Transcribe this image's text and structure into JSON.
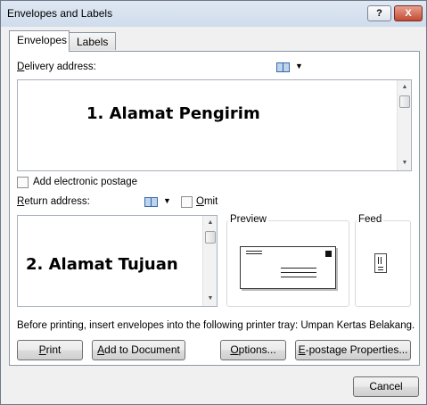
{
  "window": {
    "title": "Envelopes and Labels",
    "help_label": "?",
    "close_label": "X"
  },
  "tabs": [
    {
      "label": "Envelopes"
    },
    {
      "label": "Labels"
    }
  ],
  "delivery": {
    "label_prefix": "D",
    "label_rest": "elivery address:",
    "value": "1. Alamat Pengirim"
  },
  "electronic_postage": {
    "label": "Add electronic postage",
    "checked": false
  },
  "return": {
    "label_prefix": "R",
    "label_rest": "eturn address:",
    "value": "2. Alamat Tujuan",
    "omit_label_prefix": "O",
    "omit_label_rest": "mit",
    "omit_checked": false
  },
  "preview": {
    "title": "Preview"
  },
  "feed": {
    "title": "Feed"
  },
  "tray_message": "Before printing, insert envelopes into the following printer tray: Umpan Kertas Belakang.",
  "buttons": {
    "print_prefix": "P",
    "print_rest": "rint",
    "add_prefix": "A",
    "add_rest": "dd to Document",
    "options_prefix": "O",
    "options_rest": "ptions...",
    "epostage_prefix": "E",
    "epostage_rest": "-postage Properties...",
    "cancel": "Cancel"
  },
  "icons": {
    "address_book": "address-book-icon",
    "dropdown": "chevron-down-icon",
    "scroll_up": "scroll-up-arrow-icon",
    "scroll_down": "scroll-down-arrow-icon"
  }
}
